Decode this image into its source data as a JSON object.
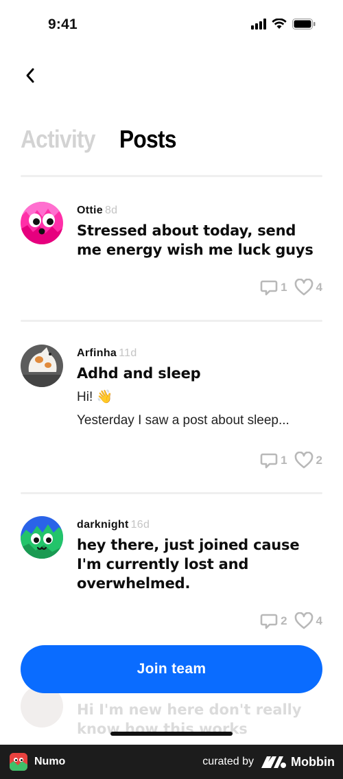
{
  "status_bar": {
    "time": "9:41"
  },
  "tabs": [
    {
      "label": "Activity",
      "active": false
    },
    {
      "label": "Posts",
      "active": true
    }
  ],
  "posts": [
    {
      "author": "Ottie",
      "age": "8d",
      "title": "Stressed about today, send me energy wish me luck guys",
      "body": [],
      "comments": "1",
      "likes": "4",
      "avatar_icon": "pink-creature-avatar"
    },
    {
      "author": "Arfinha",
      "age": "11d",
      "title": "Adhd and sleep",
      "body": [
        "Hi! 👋",
        "Yesterday I saw a post about sleep..."
      ],
      "comments": "1",
      "likes": "2",
      "avatar_icon": "blep-cat-avatar"
    },
    {
      "author": "darknight",
      "age": "16d",
      "title": "hey there, just joined cause I'm currently lost and overwhelmed.",
      "body": [],
      "comments": "2",
      "likes": "4",
      "avatar_icon": "blue-green-creature-avatar"
    }
  ],
  "faded_post": {
    "title": "Hi I'm new here don't really know how this works"
  },
  "join_button": {
    "label": "Join team"
  },
  "footer": {
    "app_name": "Numo",
    "curated_by": "curated by",
    "brand": "Mobbin"
  },
  "colors": {
    "accent": "#0a6cff",
    "inactive_tab": "#d3d3d3",
    "meta_gray": "#c4c4c4"
  }
}
